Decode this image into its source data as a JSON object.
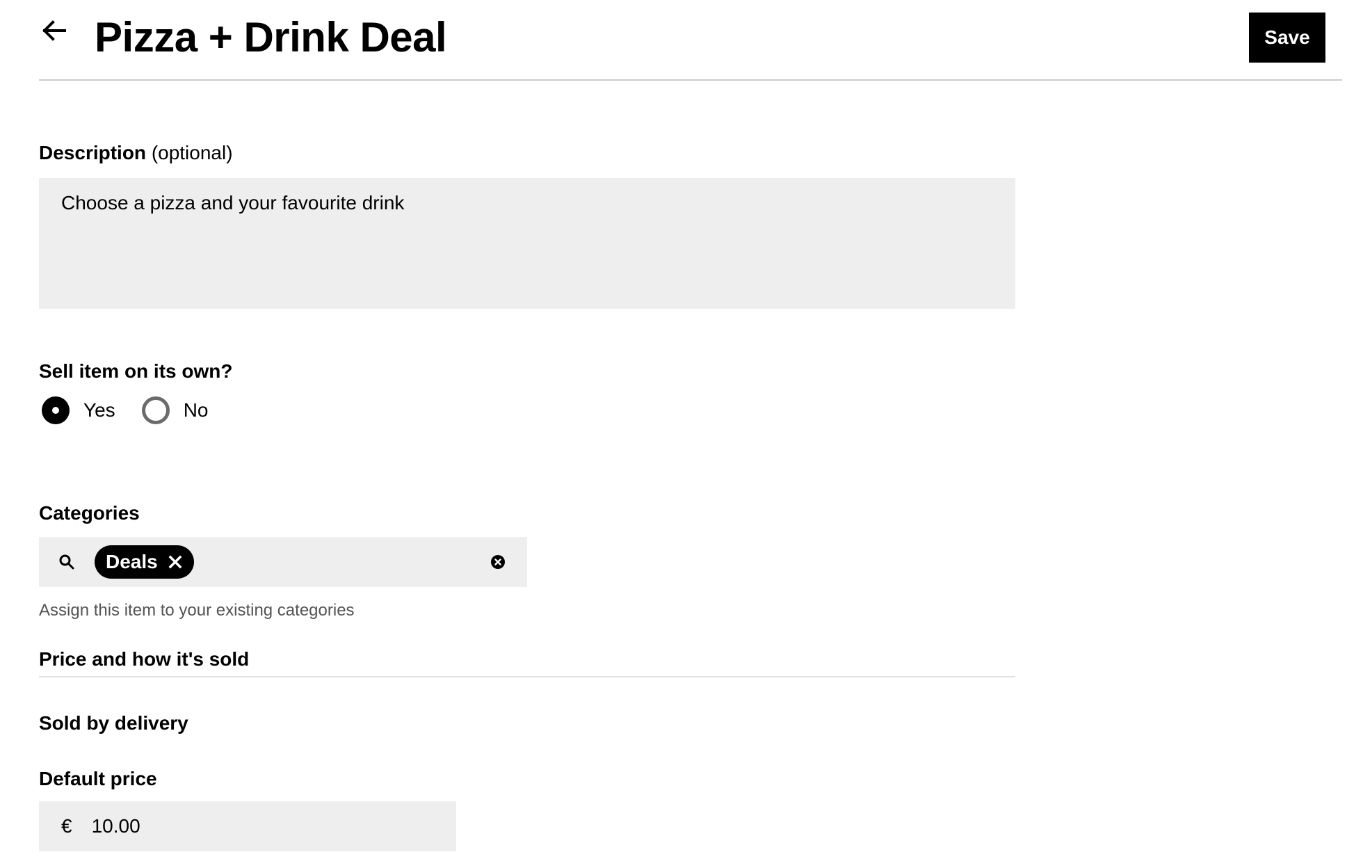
{
  "header": {
    "back_icon": "arrow-left-icon",
    "title": "Pizza + Drink Deal",
    "save_label": "Save"
  },
  "description": {
    "label": "Description",
    "optional_text": "(optional)",
    "value": "Choose a pizza and your favourite drink"
  },
  "sell_on_own": {
    "label": "Sell item on its own?",
    "options": [
      {
        "label": "Yes",
        "selected": true
      },
      {
        "label": "No",
        "selected": false
      }
    ]
  },
  "categories": {
    "label": "Categories",
    "search_icon": "search-icon",
    "chips": [
      {
        "label": "Deals",
        "remove_icon": "close-icon"
      }
    ],
    "clear_icon": "clear-circle-icon",
    "helper": "Assign this item to your existing categories"
  },
  "pricing": {
    "section_title": "Price and how it's sold",
    "sold_by_label": "Sold by delivery",
    "default_price_label": "Default price",
    "currency_symbol": "€",
    "default_price_value": "10.00"
  },
  "colors": {
    "primary": "#000000",
    "field_background": "#eeeeee",
    "helper_text": "#545454",
    "divider": "#cccccc",
    "radio_unchecked": "#6b6b6b"
  }
}
